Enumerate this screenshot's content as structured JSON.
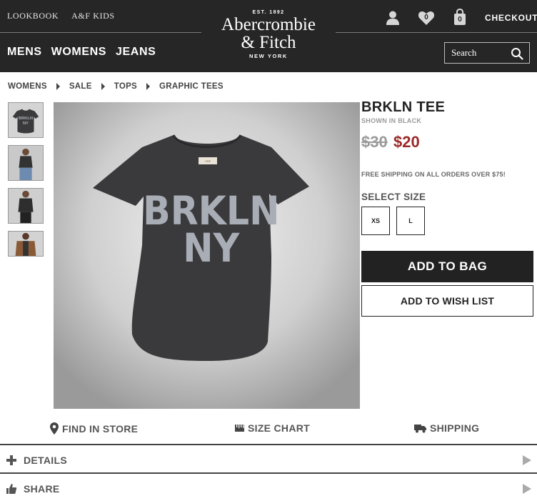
{
  "header": {
    "util_links": [
      "LOOKBOOK",
      "A&F KIDS"
    ],
    "logo": {
      "est": "EST. 1892",
      "line1": "Abercrombie",
      "line2": "& Fitch",
      "city": "NEW YORK"
    },
    "wishlist_count": "0",
    "bag_count": "0",
    "checkout_label": "CHECKOUT",
    "nav": [
      "MENS",
      "WOMENS",
      "JEANS"
    ],
    "search_placeholder": "Search"
  },
  "breadcrumb": [
    "WOMENS",
    "SALE",
    "TOPS",
    "GRAPHIC TEES"
  ],
  "product": {
    "title": "BRKLN TEE",
    "shown_in": "SHOWN IN BLACK",
    "price_original": "$30",
    "price_sale": "$20",
    "shipping_note": "FREE SHIPPING ON ALL ORDERS OVER $75!",
    "select_size_label": "SELECT SIZE",
    "sizes": [
      "XS",
      "L"
    ],
    "add_to_bag_label": "ADD TO BAG",
    "add_to_wishlist_label": "ADD TO WISH LIST",
    "tee_graphic_line1": "BRKLN",
    "tee_graphic_line2": "NY"
  },
  "utility": {
    "find_in_store": "FIND IN STORE",
    "size_chart": "SIZE CHART",
    "shipping": "SHIPPING"
  },
  "accordion": {
    "details": "DETAILS",
    "share": "SHARE"
  },
  "colors": {
    "header_bg": "#262626",
    "sale_price": "#9b2a2a",
    "tee": "#3a3a3c",
    "tee_print": "#a9adb6"
  }
}
